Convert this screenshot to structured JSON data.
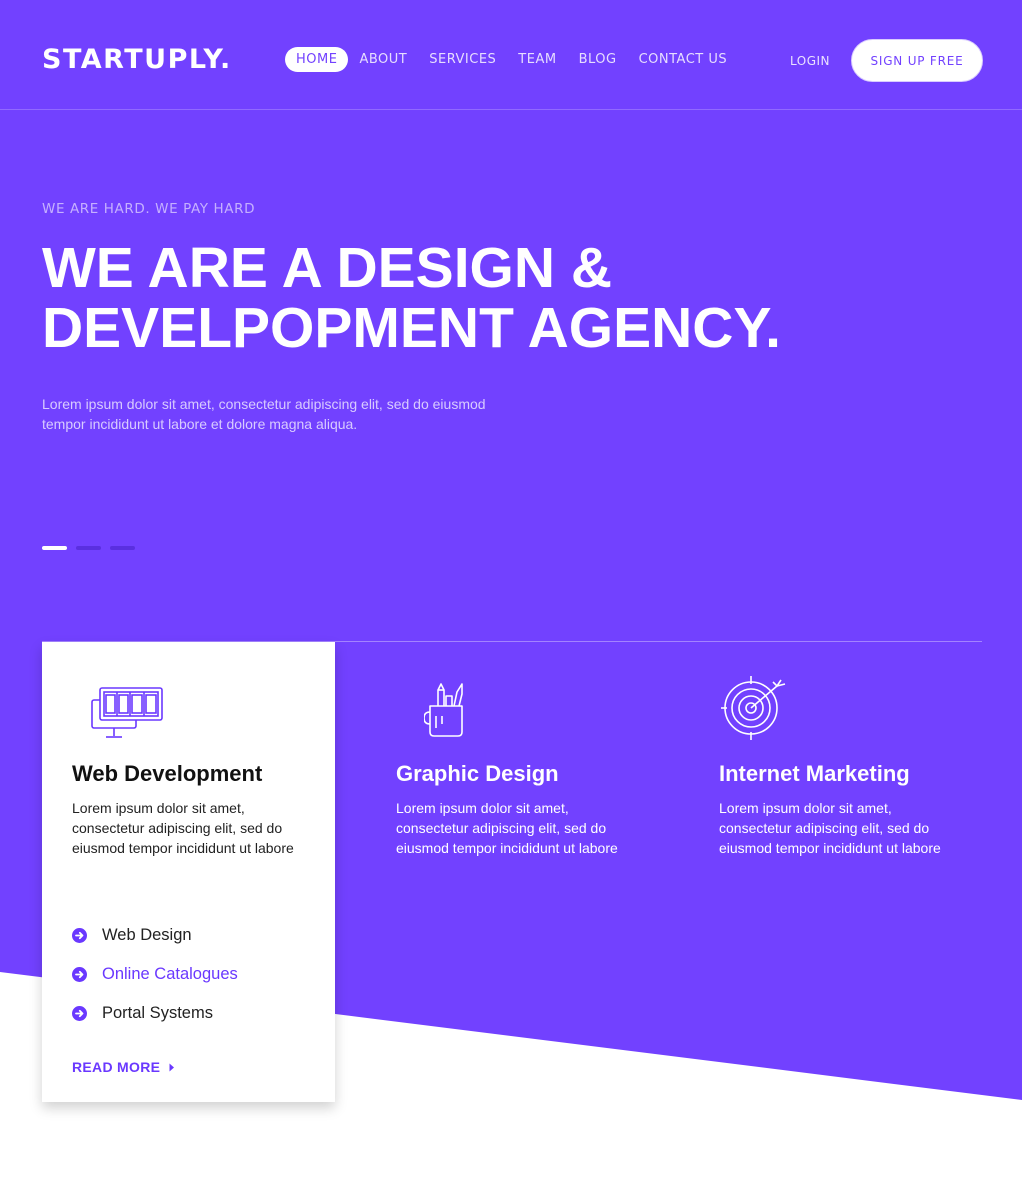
{
  "colors": {
    "primary": "#7241ff",
    "accent": "#6a38ff",
    "white": "#ffffff"
  },
  "header": {
    "logo": "STARTUPLY.",
    "nav": [
      {
        "label": "HOME",
        "active": true
      },
      {
        "label": "ABOUT",
        "active": false
      },
      {
        "label": "SERVICES",
        "active": false
      },
      {
        "label": "TEAM",
        "active": false
      },
      {
        "label": "BLOG",
        "active": false
      },
      {
        "label": "CONTACT US",
        "active": false
      }
    ],
    "login": "LOGIN",
    "signup": "SIGN UP FREE"
  },
  "hero": {
    "eyebrow": "WE ARE HARD. WE PAY HARD",
    "headline_line1": "WE ARE A DESIGN &",
    "headline_line2": "DEVELPOPMENT AGENCY.",
    "text": "Lorem ipsum dolor sit amet, consectetur adipiscing elit, sed do eiusmod tempor incididunt ut labore et dolore magna aliqua.",
    "slides": 3,
    "active_slide": 0
  },
  "services": [
    {
      "icon": "monitor-icon",
      "title": "Web Development",
      "desc": "Lorem ipsum dolor sit amet, consectetur adipiscing elit, sed do eiusmod tempor incididunt ut labore",
      "list": [
        "Web Design",
        "Online Catalogues",
        "Portal Systems"
      ],
      "read_more": "READ MORE"
    },
    {
      "icon": "pencil-cup-icon",
      "title": "Graphic Design",
      "desc": "Lorem ipsum dolor sit amet, consectetur adipiscing elit, sed do eiusmod tempor incididunt ut labore"
    },
    {
      "icon": "target-icon",
      "title": "Internet Marketing",
      "desc": "Lorem ipsum dolor sit amet, consectetur adipiscing elit, sed do eiusmod tempor incididunt ut labore"
    }
  ]
}
